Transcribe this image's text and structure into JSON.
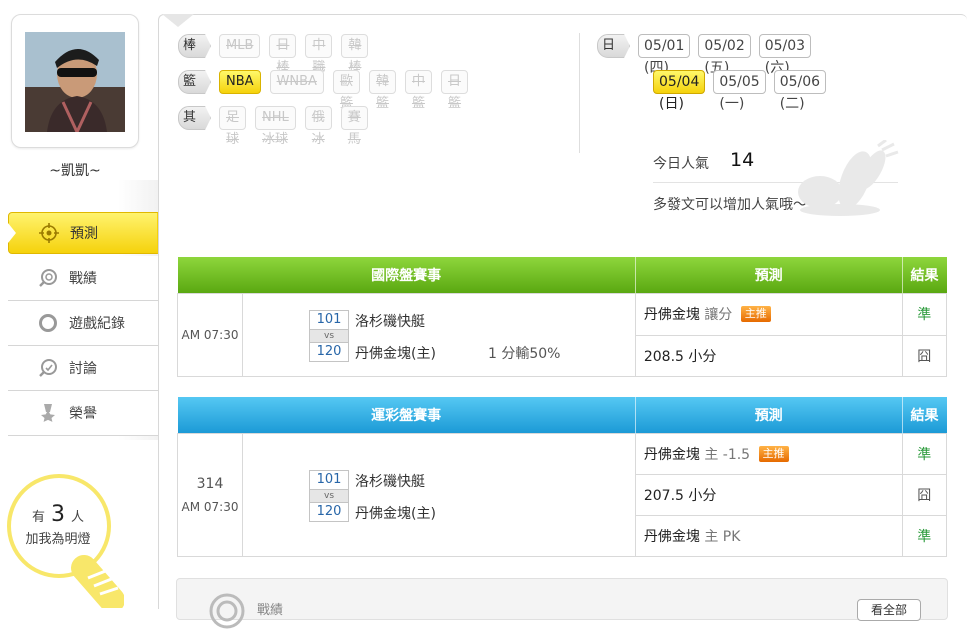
{
  "user": {
    "name": "~凱凱~"
  },
  "nav": [
    {
      "label": "預測",
      "icon": "target-icon",
      "active": true
    },
    {
      "label": "戰績",
      "icon": "search-record-icon",
      "active": false
    },
    {
      "label": "遊戲紀錄",
      "icon": "ring-icon",
      "active": false
    },
    {
      "label": "討論",
      "icon": "discussion-icon",
      "active": false
    },
    {
      "label": "榮譽",
      "icon": "medal-icon",
      "active": false
    }
  ],
  "bulb": {
    "prefix": "有",
    "count": "3",
    "suffix": "人",
    "caption": "加我為明燈"
  },
  "filters": {
    "baseball": {
      "label": "棒球",
      "items": [
        "MLB",
        "日棒",
        "中職",
        "韓棒"
      ]
    },
    "basketball": {
      "label": "籃球",
      "items": [
        "NBA",
        "WNBA",
        "歐籃",
        "韓籃",
        "中籃",
        "日籃"
      ],
      "active": "NBA"
    },
    "other": {
      "label": "其他",
      "items": [
        "足球",
        "NHL冰球",
        "俄冰",
        "賽馬"
      ]
    }
  },
  "dates": {
    "label": "日期",
    "row1": [
      "05/01 (四)",
      "05/02 (五)",
      "05/03 (六)"
    ],
    "row2": [
      "05/04 (日)",
      "05/05 (一)",
      "05/06 (二)"
    ],
    "active": "05/04 (日)"
  },
  "popularity": {
    "label": "今日人氣",
    "value": "14",
    "tip": "多發文可以增加人氣哦～"
  },
  "intl": {
    "headers": {
      "event": "國際盤賽事",
      "prediction": "預測",
      "result": "結果"
    },
    "time": "AM 07:30",
    "away": {
      "no": "101",
      "name": "洛杉磯快艇"
    },
    "home": {
      "no": "120",
      "name": "丹佛金塊(主)"
    },
    "vs": "vs",
    "odds": "1 分輸50%",
    "predictions": [
      {
        "team": "丹佛金塊",
        "detail": "讓分",
        "badge": "主推",
        "result": "準",
        "result_type": "win"
      },
      {
        "team": "208.5",
        "detail": "小分",
        "badge": "",
        "result": "囧",
        "result_type": "lose"
      }
    ]
  },
  "sports": {
    "headers": {
      "event": "運彩盤賽事",
      "prediction": "預測",
      "result": "結果"
    },
    "code": "314",
    "time": "AM 07:30",
    "away": {
      "no": "101",
      "name": "洛杉磯快艇"
    },
    "home": {
      "no": "120",
      "name": "丹佛金塊(主)"
    },
    "vs": "vs",
    "predictions": [
      {
        "team": "丹佛金塊",
        "detail": "主 -1.5",
        "badge": "主推",
        "result": "準",
        "result_type": "win"
      },
      {
        "team": "207.5",
        "detail": "小分",
        "badge": "",
        "result": "囧",
        "result_type": "lose"
      },
      {
        "team": "丹佛金塊",
        "detail": "主 PK",
        "badge": "",
        "result": "準",
        "result_type": "win"
      }
    ]
  },
  "record_box": {
    "title": "戰績",
    "button": "看全部"
  },
  "colors": {
    "accent_yellow": "#f5d20c",
    "intl_header": "#5aa811",
    "sports_header": "#1c9ad6",
    "win": "#2a9a3a",
    "badge": "#e66a00"
  }
}
